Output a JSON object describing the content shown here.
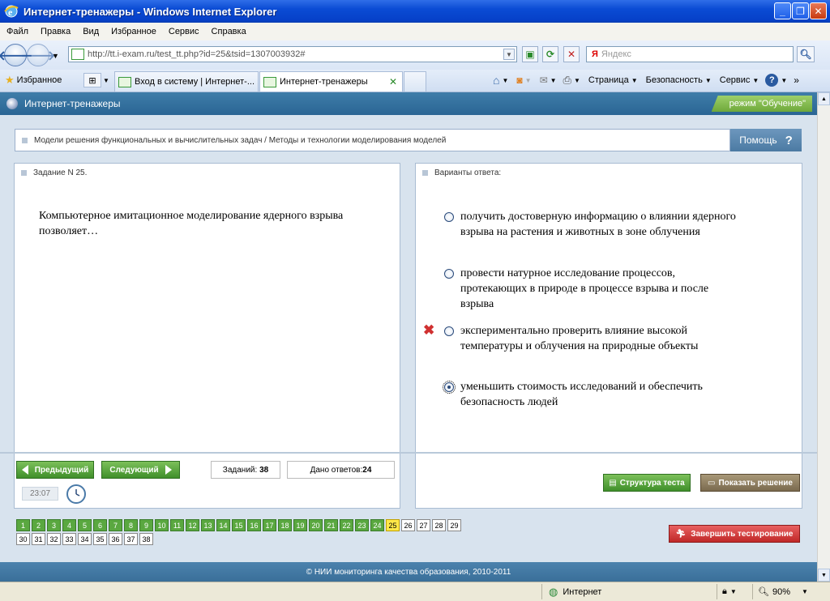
{
  "window": {
    "title": "Интернет-тренажеры - Windows Internet Explorer"
  },
  "menu": [
    "Файл",
    "Правка",
    "Вид",
    "Избранное",
    "Сервис",
    "Справка"
  ],
  "address": {
    "url": "http://tt.i-exam.ru/test_tt.php?id=25&tsid=1307003932#",
    "search_placeholder": "Яндекс"
  },
  "favorites_label": "Избранное",
  "tabs": [
    {
      "label": "Вход в систему | Интернет-..."
    },
    {
      "label": "Интернет-тренажеры"
    }
  ],
  "commands": {
    "page": "Страница",
    "safety": "Безопасность",
    "tools": "Сервис"
  },
  "app": {
    "title": "Интернет-тренажеры",
    "mode": "режим \"Обучение\""
  },
  "breadcrumb": "Модели решения функциональных и вычислительных задач / Методы и технологии моделирования моделей",
  "help_label": "Помощь",
  "task": {
    "header": "Задание N 25.",
    "text": "Компьютерное имитационное моделирование ядерного взрыва позволяет…"
  },
  "answers": {
    "header": "Варианты ответа:",
    "options": [
      {
        "text": "получить достоверную информацию о влиянии ядерного взрыва на растения и животных в зоне облучения",
        "selected": false,
        "wrong": false
      },
      {
        "text": "провести натурное исследование процессов, протекающих в природе в процессе взрыва и после взрыва",
        "selected": false,
        "wrong": false
      },
      {
        "text": "экспериментально проверить влияние высокой температуры и облучения на природные объекты",
        "selected": false,
        "wrong": true
      },
      {
        "text": "уменьшить стоимость исследований и обеспечить безопасность людей",
        "selected": true,
        "wrong": false
      }
    ]
  },
  "nav": {
    "prev": "Предыдущий",
    "next": "Следующий",
    "tasks_label": "Заданий:",
    "tasks_count": "38",
    "answered_label": "Дано ответов:",
    "answered_count": "24",
    "timer": "23:07",
    "structure": "Структура теста",
    "solution": "Показать решение",
    "finish": "Завершить тестирование"
  },
  "question_grid": {
    "total": 38,
    "current": 25,
    "answered_until": 24
  },
  "footer": "© НИИ мониторинга качества образования, 2010-2011",
  "statusbar": {
    "zone": "Интернет",
    "zoom": "90%"
  }
}
